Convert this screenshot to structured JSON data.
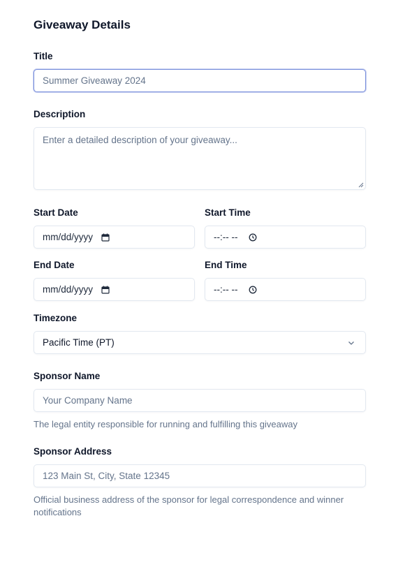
{
  "form": {
    "title": "Giveaway Details",
    "title_field": {
      "label": "Title",
      "value": "Summer Giveaway 2024"
    },
    "description_field": {
      "label": "Description",
      "placeholder": "Enter a detailed description of your giveaway..."
    },
    "start_date": {
      "label": "Start Date",
      "value": "mm/dd/yyyy",
      "icon": "calendar-icon"
    },
    "start_time": {
      "label": "Start Time",
      "value": "--:-- --",
      "icon": "clock-icon"
    },
    "end_date": {
      "label": "End Date",
      "value": "mm/dd/yyyy",
      "icon": "calendar-icon"
    },
    "end_time": {
      "label": "End Time",
      "value": "--:-- --",
      "icon": "clock-icon"
    },
    "timezone": {
      "label": "Timezone",
      "selected": "Pacific Time (PT)",
      "icon": "chevron-down-icon"
    },
    "sponsor_name": {
      "label": "Sponsor Name",
      "placeholder": "Your Company Name",
      "help": "The legal entity responsible for running and fulfilling this giveaway"
    },
    "sponsor_address": {
      "label": "Sponsor Address",
      "placeholder": "123 Main St, City, State 12345",
      "help": "Official business address of the sponsor for legal correspondence and winner notifications"
    }
  },
  "colors": {
    "text": "#0f172a",
    "muted": "#64748b",
    "border": "#e2e8f0",
    "focus_border": "#7b90dc"
  }
}
